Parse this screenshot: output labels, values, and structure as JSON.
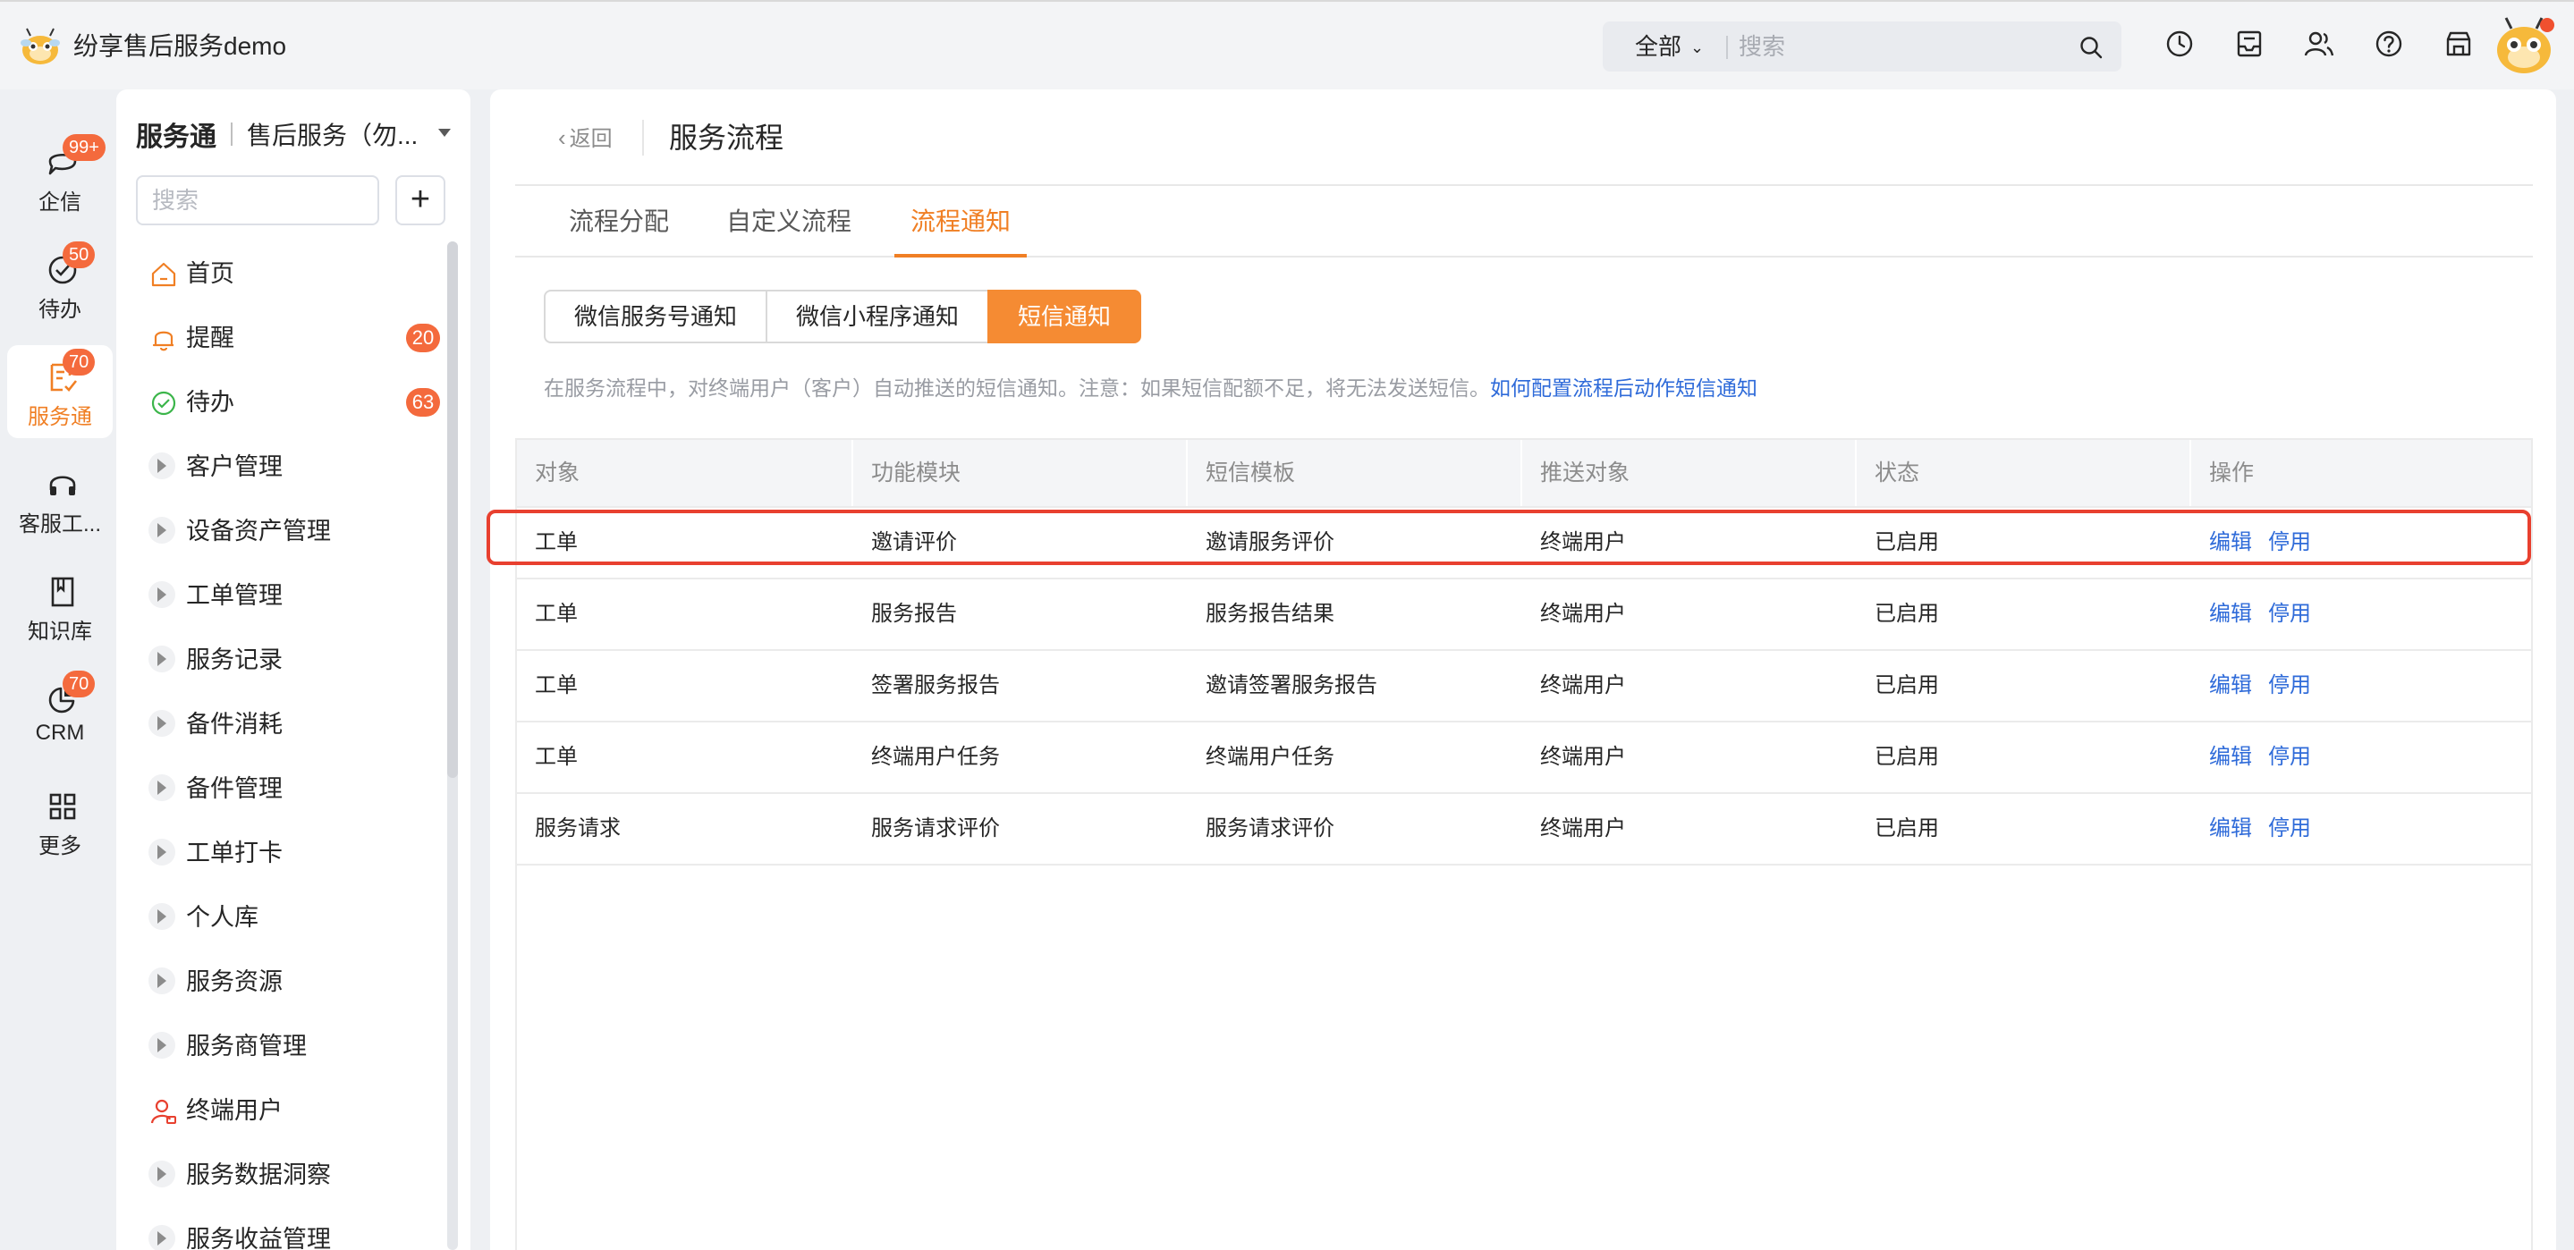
{
  "app": {
    "title": "纷享售后服务demo"
  },
  "search": {
    "scope": "全部",
    "placeholder": "搜索"
  },
  "rail": [
    {
      "label": "企信",
      "badge": "99+",
      "icon": "chat-bubble-icon"
    },
    {
      "label": "待办",
      "badge": "50",
      "icon": "check-circle-icon"
    },
    {
      "label": "服务通",
      "badge": "70",
      "icon": "service-doc-icon",
      "active": true
    },
    {
      "label": "客服工...",
      "badge": "",
      "icon": "headset-icon"
    },
    {
      "label": "知识库",
      "badge": "",
      "icon": "book-icon"
    },
    {
      "label": "CRM",
      "badge": "70",
      "icon": "pie-chart-icon"
    },
    {
      "label": "更多",
      "badge": "",
      "icon": "grid-icon"
    }
  ],
  "subnav": {
    "title": "服务通",
    "subtitle": "售后服务（勿...",
    "search_placeholder": "搜索",
    "add_label": "+",
    "items": [
      {
        "label": "首页",
        "badge": ""
      },
      {
        "label": "提醒",
        "badge": "20"
      },
      {
        "label": "待办",
        "badge": "63"
      },
      {
        "label": "客户管理",
        "badge": ""
      },
      {
        "label": "设备资产管理",
        "badge": ""
      },
      {
        "label": "工单管理",
        "badge": ""
      },
      {
        "label": "服务记录",
        "badge": ""
      },
      {
        "label": "备件消耗",
        "badge": ""
      },
      {
        "label": "备件管理",
        "badge": ""
      },
      {
        "label": "工单打卡",
        "badge": ""
      },
      {
        "label": "个人库",
        "badge": ""
      },
      {
        "label": "服务资源",
        "badge": ""
      },
      {
        "label": "服务商管理",
        "badge": ""
      },
      {
        "label": "终端用户",
        "badge": ""
      },
      {
        "label": "服务数据洞察",
        "badge": ""
      },
      {
        "label": "服务收益管理",
        "badge": ""
      }
    ]
  },
  "main": {
    "back_label": "返回",
    "title": "服务流程",
    "tabs": [
      "流程分配",
      "自定义流程",
      "流程通知"
    ],
    "active_tab": 2,
    "channels": [
      "微信服务号通知",
      "微信小程序通知",
      "短信通知"
    ],
    "active_channel": 2,
    "hint": "在服务流程中，对终端用户（客户）自动推送的短信通知。注意：如果短信配额不足，将无法发送短信。",
    "hint_link": "如何配置流程后动作短信通知",
    "table": {
      "columns": [
        "对象",
        "功能模块",
        "短信模板",
        "推送对象",
        "状态",
        "操作"
      ],
      "rows": [
        [
          "工单",
          "邀请评价",
          "邀请服务评价",
          "终端用户",
          "已启用"
        ],
        [
          "工单",
          "服务报告",
          "服务报告结果",
          "终端用户",
          "已启用"
        ],
        [
          "工单",
          "签署服务报告",
          "邀请签署服务报告",
          "终端用户",
          "已启用"
        ],
        [
          "工单",
          "终端用户任务",
          "终端用户任务",
          "终端用户",
          "已启用"
        ],
        [
          "服务请求",
          "服务请求评价",
          "服务请求评价",
          "终端用户",
          "已启用"
        ]
      ],
      "actions": [
        "编辑",
        "停用"
      ]
    }
  },
  "colors": {
    "accent": "#f07f24",
    "link": "#2f6bd9",
    "badge": "#f46a3d",
    "highlight": "#e8402f"
  }
}
